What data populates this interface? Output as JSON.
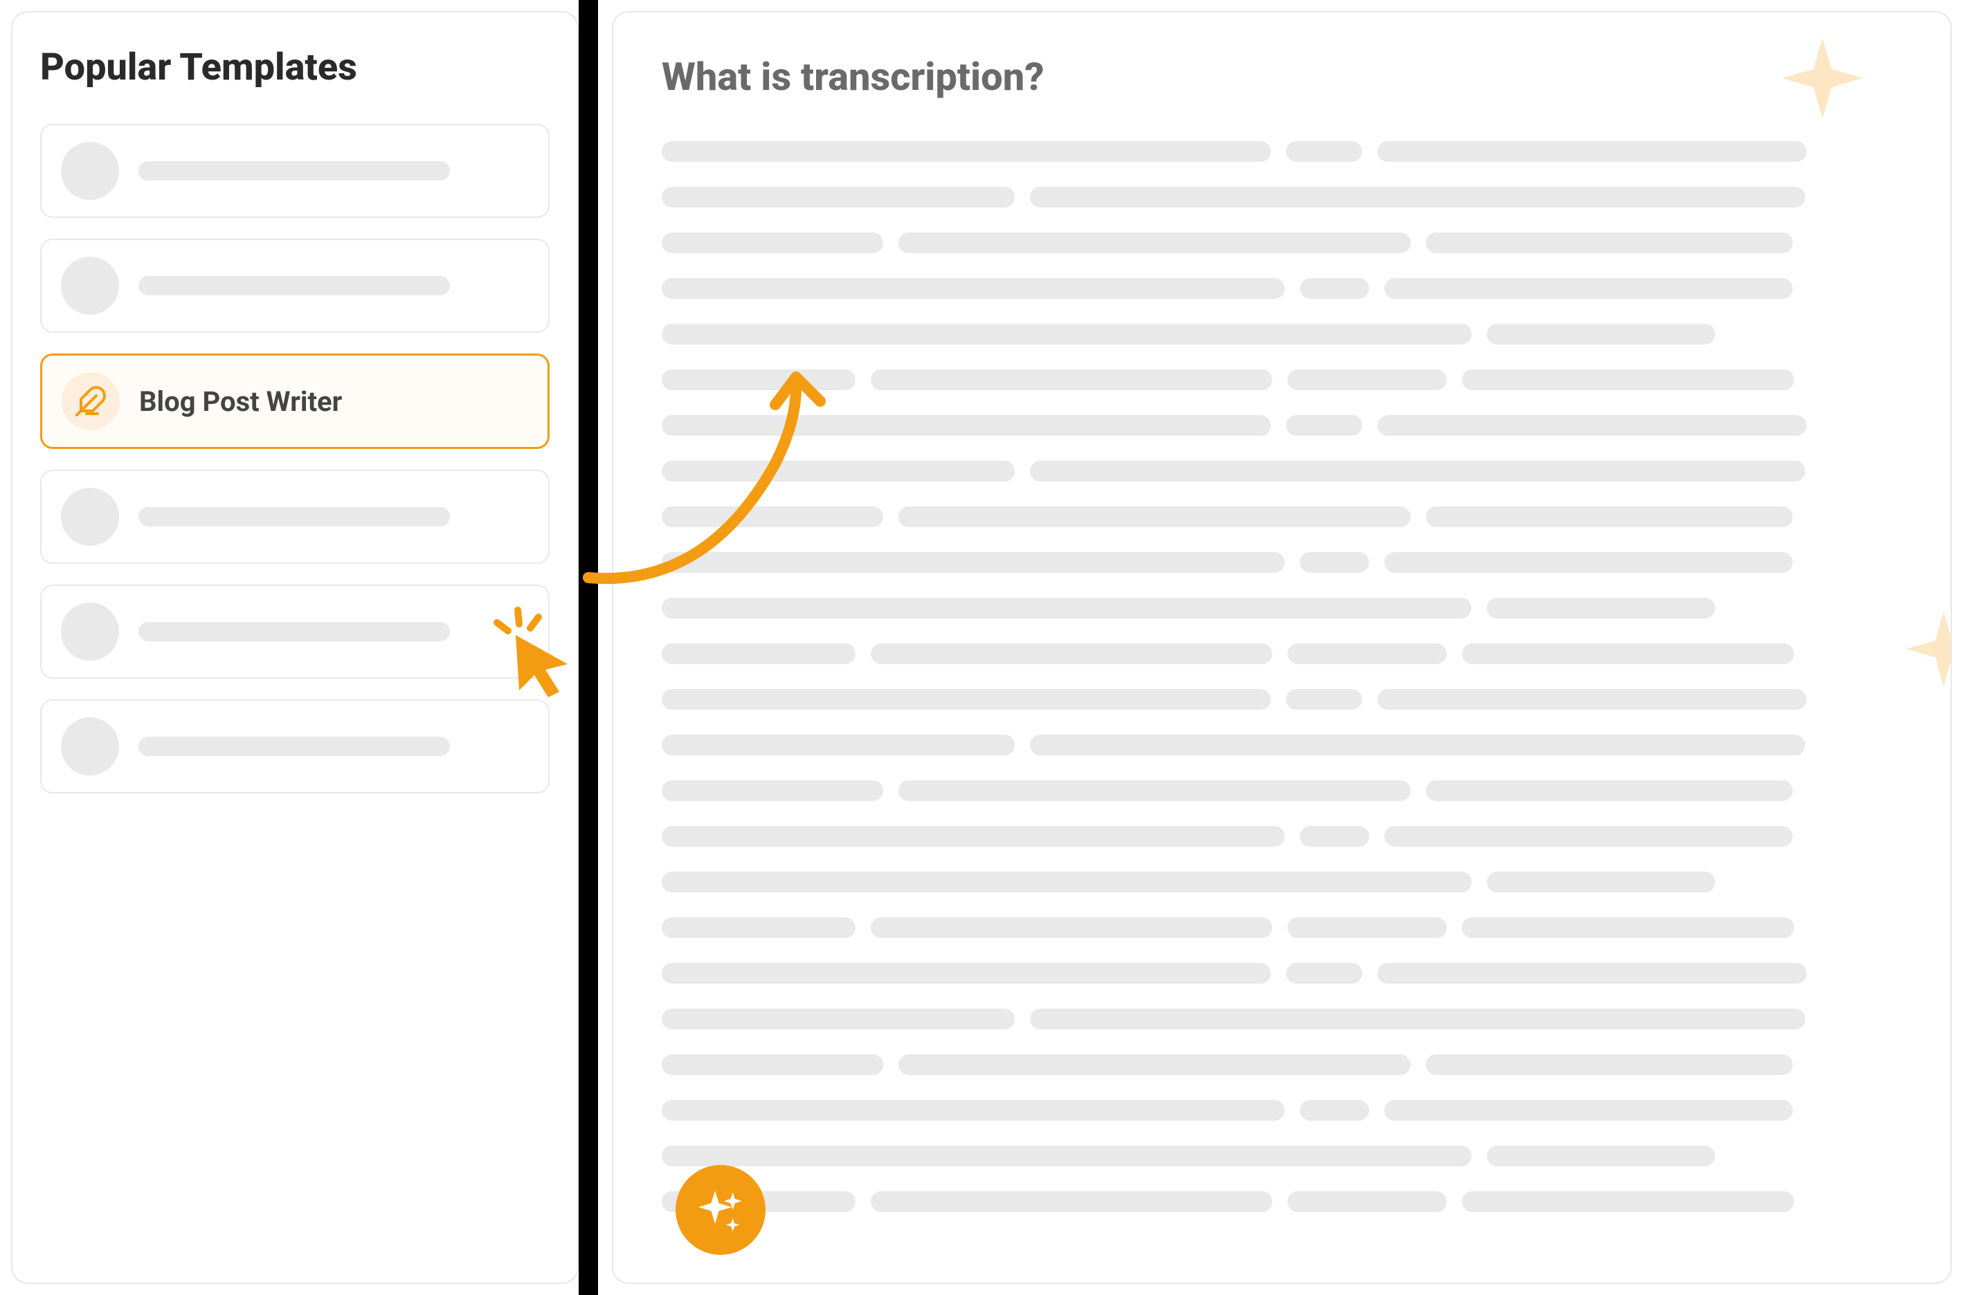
{
  "sidebar": {
    "title": "Popular Templates",
    "items": [
      {
        "label": "",
        "selected": false
      },
      {
        "label": "",
        "selected": false
      },
      {
        "label": "Blog Post Writer",
        "selected": true,
        "icon": "feather"
      },
      {
        "label": "",
        "selected": false
      },
      {
        "label": "",
        "selected": false
      },
      {
        "label": "",
        "selected": false
      }
    ]
  },
  "main": {
    "title": "What is transcription?"
  },
  "colors": {
    "accent": "#f39c12",
    "placeholder": "#e9e9e9",
    "border": "#e8e8e8",
    "starFill": "#fce6c4"
  }
}
